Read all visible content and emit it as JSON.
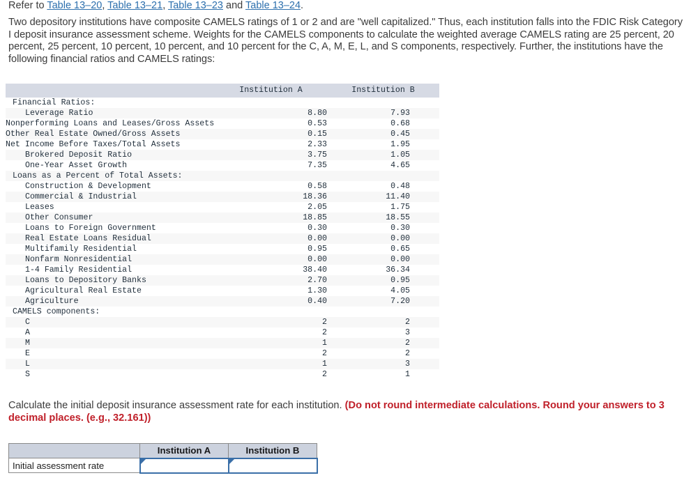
{
  "intro": {
    "refer_prefix": "Refer to ",
    "refer_links": [
      "Table 13–20",
      "Table 13–21",
      "Table 13–23",
      "Table 13–24"
    ],
    "refer_sep1": ", ",
    "refer_sep2": ", ",
    "refer_and": " and ",
    "refer_suffix": ".",
    "paragraph": "Two depository institutions have composite CAMELS ratings of 1 or 2 and are \"well capitalized.\" Thus, each institution falls into the FDIC Risk Category I deposit insurance assessment scheme. Weights for the CAMELS components to calculate the weighted average CAMELS rating are 25 percent, 20 percent, 25 percent, 10 percent, 10 percent, and 10 percent for the C, A, M, E, L, and S components, respectively. Further, the institutions have the following financial ratios and CAMELS ratings:"
  },
  "data_table": {
    "headers": [
      "",
      "Institution A",
      "Institution B"
    ],
    "section_1_title": "Financial Ratios:",
    "section_1_rows": [
      {
        "label": "Leverage Ratio",
        "a": "8.80",
        "b": "7.93"
      },
      {
        "label": "Nonperforming Loans and Leases/Gross Assets",
        "a": "0.53",
        "b": "0.68"
      },
      {
        "label": "Other Real Estate Owned/Gross Assets",
        "a": "0.15",
        "b": "0.45"
      },
      {
        "label": "Net Income Before Taxes/Total Assets",
        "a": "2.33",
        "b": "1.95"
      },
      {
        "label": "Brokered Deposit Ratio",
        "a": "3.75",
        "b": "1.05"
      },
      {
        "label": "One-Year Asset Growth",
        "a": "7.35",
        "b": "4.65"
      }
    ],
    "section_2_title": "Loans as a Percent of Total Assets:",
    "section_2_rows": [
      {
        "label": "Construction & Development",
        "a": "0.58",
        "b": "0.48"
      },
      {
        "label": "Commercial & Industrial",
        "a": "18.36",
        "b": "11.40"
      },
      {
        "label": "Leases",
        "a": "2.05",
        "b": "1.75"
      },
      {
        "label": "Other Consumer",
        "a": "18.85",
        "b": "18.55"
      },
      {
        "label": "Loans to Foreign Government",
        "a": "0.30",
        "b": "0.30"
      },
      {
        "label": "Real Estate Loans Residual",
        "a": "0.00",
        "b": "0.00"
      },
      {
        "label": "Multifamily Residential",
        "a": "0.95",
        "b": "0.65"
      },
      {
        "label": "Nonfarm Nonresidential",
        "a": "0.00",
        "b": "0.00"
      },
      {
        "label": "1-4 Family Residential",
        "a": "38.40",
        "b": "36.34"
      },
      {
        "label": "Loans to Depository Banks",
        "a": "2.70",
        "b": "0.95"
      },
      {
        "label": "Agricultural Real Estate",
        "a": "1.30",
        "b": "4.05"
      },
      {
        "label": "Agriculture",
        "a": "0.40",
        "b": "7.20"
      }
    ],
    "section_3_title": "CAMELS components:",
    "section_3_rows": [
      {
        "label": "C",
        "a": "2",
        "b": "2"
      },
      {
        "label": "A",
        "a": "2",
        "b": "3"
      },
      {
        "label": "M",
        "a": "1",
        "b": "2"
      },
      {
        "label": "E",
        "a": "2",
        "b": "2"
      },
      {
        "label": "L",
        "a": "1",
        "b": "3"
      },
      {
        "label": "S",
        "a": "2",
        "b": "1"
      }
    ]
  },
  "question": {
    "plain": "Calculate the initial deposit insurance assessment rate for each institution. ",
    "emphasis": "(Do not round intermediate calculations. Round your answers to 3 decimal places. (e.g., 32.161))"
  },
  "answer_table": {
    "headers": [
      "",
      "Institution A",
      "Institution B"
    ],
    "row_label": "Initial assessment rate",
    "value_a": "",
    "value_b": "",
    "placeholder_a": "",
    "placeholder_b": ""
  },
  "colors": {
    "link": "#2c6fad",
    "emphasis": "#c0202a",
    "header_bg": "#d6dae4",
    "answer_header_bg": "#ccd2de",
    "input_border": "#3a6fa8",
    "row_shade": "#f7f7f7"
  }
}
